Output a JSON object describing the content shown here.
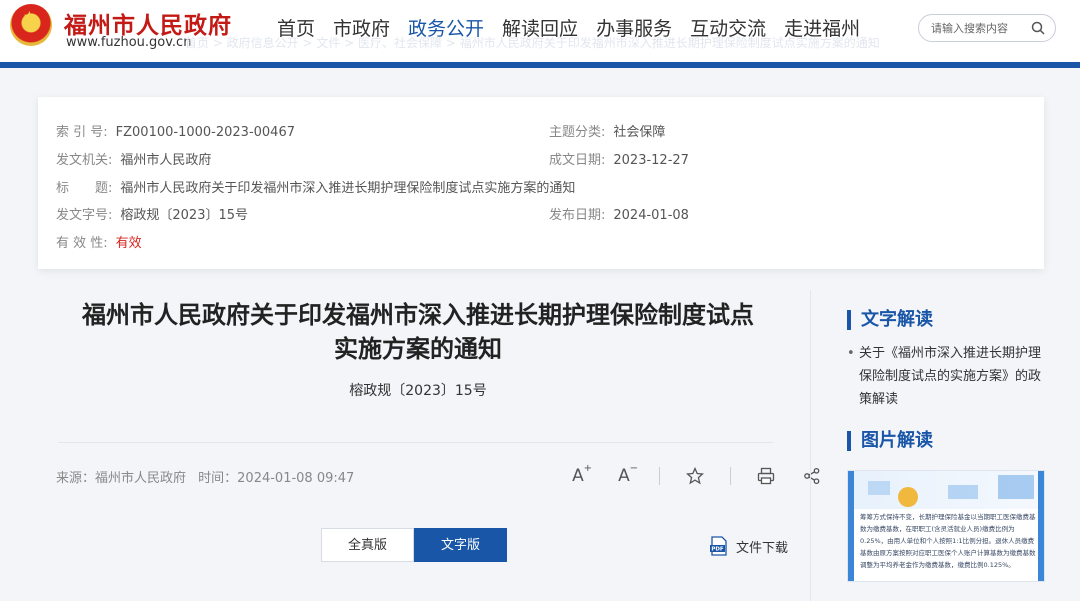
{
  "site": {
    "name": "福州市人民政府",
    "url": "www.fuzhou.gov.cn",
    "ghost_text": "首页 > 政府信息公开 > 文件 > 医疗、社会保障 > 福州市人民政府关于印发福州市深入推进长期护理保险制度试点实施方案的通知"
  },
  "nav": {
    "items": [
      "首页",
      "市政府",
      "政务公开",
      "解读回应",
      "办事服务",
      "互动交流",
      "走进福州"
    ],
    "active_index": 2
  },
  "search": {
    "placeholder": "请输入搜索内容"
  },
  "info": {
    "index_label": "索 引 号:",
    "index_value": "FZ00100-1000-2023-00467",
    "topic_label": "主题分类:",
    "topic_value": "社会保障",
    "issuer_label": "发文机关:",
    "issuer_value": "福州市人民政府",
    "date_label": "成文日期:",
    "date_value": "2023-12-27",
    "title_label": "标　　题:",
    "title_value": "福州市人民政府关于印发福州市深入推进长期护理保险制度试点实施方案的通知",
    "docno_label": "发文字号:",
    "docno_value": "榕政规〔2023〕15号",
    "publish_label": "发布日期:",
    "publish_value": "2024-01-08",
    "valid_label": "有 效 性:",
    "valid_value": "有效"
  },
  "doc": {
    "title_line1": "福州市人民政府关于印发福州市深入推进长期护理保险制度试点",
    "title_line2": "实施方案的通知",
    "number": "榕政规〔2023〕15号",
    "source": "来源：福州市人民政府",
    "time": "时间：2024-01-08 09:47"
  },
  "tools": {
    "font_increase": "A",
    "font_decrease": "A",
    "plus": "+",
    "minus": "−"
  },
  "tabs": {
    "full": "全真版",
    "text": "文字版"
  },
  "download": {
    "label": "文件下载",
    "badge": "PDF"
  },
  "sidebar": {
    "text_head": "文字解读",
    "text_item": "关于《福州市深入推进长期护理保险制度试点的实施方案》的政策解读",
    "image_head": "图片解读",
    "thumb_text": "筹筹方式保持不变，长期护理保险基金以当期职工医保缴费基数为缴费基数，在职职工(含灵活就业人员)缴费比例为0.25%，由用人单位和个人按照1:1比例分担。退休人员缴费基数由原方案按照对应职工医保个人账户计算基数为缴费基数调整为平均养老金作为缴费基数，缴费比例0.125%。"
  }
}
